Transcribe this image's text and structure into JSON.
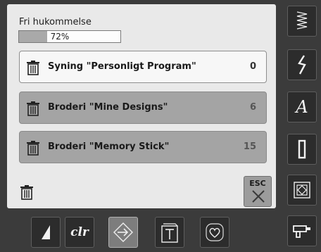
{
  "memory": {
    "label": "Fri hukommelse",
    "percent_text": "72%",
    "percent_value": 72
  },
  "rows": [
    {
      "label": "Syning \"Personligt Program\"",
      "count": "0"
    },
    {
      "label": "Broderi  \"Mine Designs\"",
      "count": "6"
    },
    {
      "label": "Broderi \"Memory Stick\"",
      "count": "15"
    }
  ],
  "esc": {
    "label": "ESC"
  },
  "bottombar": {
    "clr_label": "clr"
  },
  "rightbar": {
    "alphabet_label": "A"
  },
  "icons": {
    "trash": "trash-icon",
    "zigzag": "zigzag-stitch-icon",
    "stitch": "decorative-stitch-icon",
    "alphabet": "alphabet-icon",
    "buttonhole": "buttonhole-icon",
    "quilt": "quilt-icon",
    "drill": "machine-icon",
    "wedge": "needle-position-icon",
    "arrow": "memory-arrow-icon",
    "sheet": "paper-icon",
    "heart": "heart-icon",
    "close": "close-icon"
  }
}
